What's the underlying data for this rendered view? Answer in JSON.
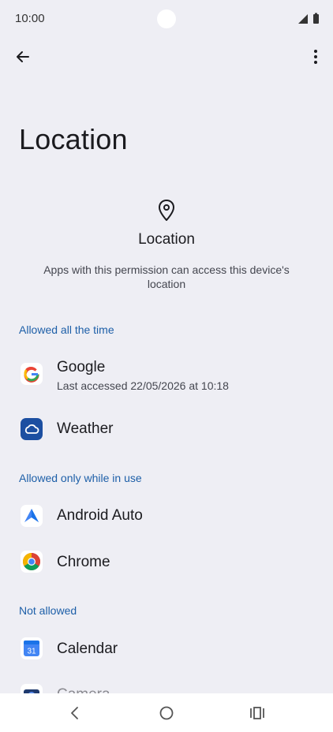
{
  "status_bar": {
    "time": "10:00"
  },
  "page": {
    "title": "Location",
    "hero_title": "Location",
    "hero_description": "Apps with this permission can access this device's location"
  },
  "sections": [
    {
      "header": "Allowed all the time",
      "apps": [
        {
          "name": "Google",
          "subtitle": "Last accessed 22/05/2026 at 10:18",
          "icon": "google-icon"
        },
        {
          "name": "Weather",
          "icon": "weather-icon"
        }
      ]
    },
    {
      "header": "Allowed only while in use",
      "apps": [
        {
          "name": "Android Auto",
          "icon": "android-auto-icon"
        },
        {
          "name": "Chrome",
          "icon": "chrome-icon"
        }
      ]
    },
    {
      "header": "Not allowed",
      "apps": [
        {
          "name": "Calendar",
          "icon": "calendar-icon",
          "icon_text": "31"
        },
        {
          "name": "Camera",
          "icon": "camera-icon"
        }
      ]
    }
  ],
  "nav_bar": {
    "icons": [
      "back-nav-icon",
      "home-nav-icon",
      "recents-nav-icon"
    ]
  },
  "colors": {
    "background": "#EEEEF4",
    "accent": "#1D5FA8",
    "weather_icon_bg": "#1C4FA1"
  }
}
